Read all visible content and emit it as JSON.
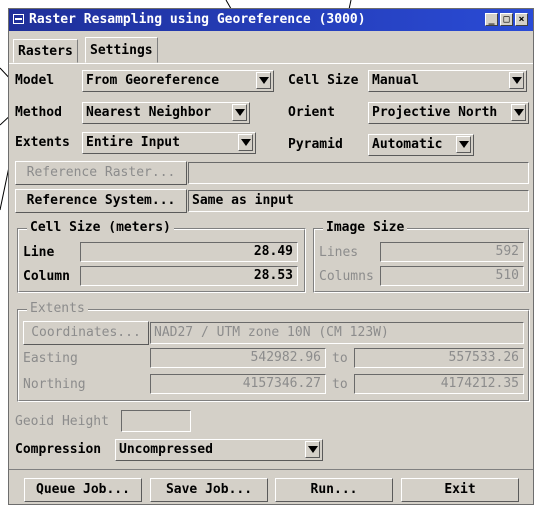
{
  "window": {
    "title": "Raster Resampling using Georeference (3000)",
    "controls": {
      "minimize": "_",
      "maximize": "□",
      "close": "×"
    }
  },
  "tabs": [
    {
      "label": "Rasters",
      "active": false
    },
    {
      "label": "Settings",
      "active": true
    }
  ],
  "settings": {
    "model_label": "Model",
    "model_value": "From Georeference",
    "method_label": "Method",
    "method_value": "Nearest Neighbor",
    "extents_label": "Extents",
    "extents_value": "Entire Input",
    "cellsize_label": "Cell Size",
    "cellsize_value": "Manual",
    "orient_label": "Orient",
    "orient_value": "Projective North",
    "pyramid_label": "Pyramid",
    "pyramid_value": "Automatic",
    "reference_raster_button": "Reference Raster...",
    "reference_raster_value": "",
    "reference_system_button": "Reference System...",
    "reference_system_value": "Same as input"
  },
  "cell_size": {
    "title": "Cell Size (meters)",
    "line_label": "Line",
    "line_value": "28.49",
    "column_label": "Column",
    "column_value": "28.53"
  },
  "image_size": {
    "title": "Image Size",
    "lines_label": "Lines",
    "lines_value": "592",
    "columns_label": "Columns",
    "columns_value": "510"
  },
  "extents": {
    "title": "Extents",
    "coordinates_button": "Coordinates...",
    "coordinates_value": "NAD27 / UTM zone 10N (CM 123W)",
    "easting_label": "Easting",
    "easting_from": "542982.96",
    "easting_to_label": "to",
    "easting_to": "557533.26",
    "northing_label": "Northing",
    "northing_from": "4157346.27",
    "northing_to_label": "to",
    "northing_to": "4174212.35"
  },
  "geoid": {
    "label": "Geoid Height",
    "value": ""
  },
  "compression": {
    "label": "Compression",
    "value": "Uncompressed"
  },
  "buttons": {
    "queue": "Queue Job...",
    "save": "Save Job...",
    "run": "Run...",
    "exit": "Exit"
  },
  "colors": {
    "titlebar": "#2a4bd6",
    "dialog_bg": "#d4d0c8",
    "disabled_text": "#8c8c8c"
  }
}
